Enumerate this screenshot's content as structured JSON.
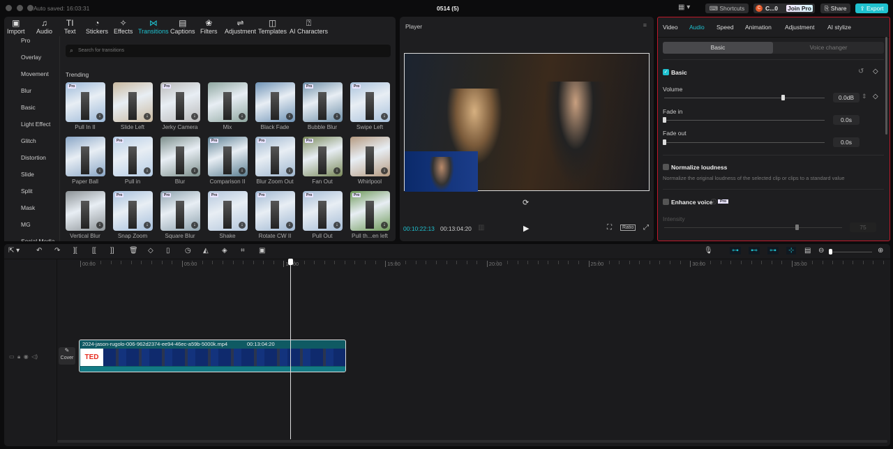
{
  "titlebar": {
    "autosave": "Auto saved: 16:03:31",
    "project": "0514 (5)",
    "shortcuts": "Shortcuts",
    "user": "C...0",
    "user_initial": "C",
    "join_pro": "Join Pro",
    "share": "Share",
    "export": "Export"
  },
  "toolbar": [
    {
      "icon": "import-icon",
      "glyph": "▣",
      "label": "Import"
    },
    {
      "icon": "audio-icon",
      "glyph": "♫",
      "label": "Audio"
    },
    {
      "icon": "text-icon",
      "glyph": "TI",
      "label": "Text"
    },
    {
      "icon": "stickers-icon",
      "glyph": "◔",
      "label": "Stickers"
    },
    {
      "icon": "effects-icon",
      "glyph": "✧",
      "label": "Effects"
    },
    {
      "icon": "transitions-icon",
      "glyph": "⋈",
      "label": "Transitions",
      "active": true
    },
    {
      "icon": "captions-icon",
      "glyph": "▤",
      "label": "Captions"
    },
    {
      "icon": "filters-icon",
      "glyph": "❀",
      "label": "Filters"
    },
    {
      "icon": "adjustment-icon",
      "glyph": "⇌",
      "label": "Adjustment"
    },
    {
      "icon": "templates-icon",
      "glyph": "◫",
      "label": "Templates"
    },
    {
      "icon": "ai-characters-icon",
      "glyph": "⍰",
      "label": "AI Characters"
    }
  ],
  "sidebar": [
    "Pro",
    "Overlay",
    "Movement",
    "Blur",
    "Basic",
    "Light Effect",
    "Glitch",
    "Distortion",
    "Slide",
    "Split",
    "Mask",
    "MG",
    "Social Media"
  ],
  "search": {
    "placeholder": "Search for transitions"
  },
  "section_title": "Trending",
  "transitions": [
    {
      "name": "Pull In II",
      "pro": true,
      "c": "#9bb8d8"
    },
    {
      "name": "Slide Left",
      "pro": false,
      "c": "#c9b9a0"
    },
    {
      "name": "Jerky Camera",
      "pro": true,
      "c": "#b9b9b9"
    },
    {
      "name": "Mix",
      "pro": false,
      "c": "#8fa7a0"
    },
    {
      "name": "Black Fade",
      "pro": false,
      "c": "#6f93b6"
    },
    {
      "name": "Bubble Blur",
      "pro": true,
      "c": "#6e8fa8"
    },
    {
      "name": "Swipe Left",
      "pro": true,
      "c": "#a9c2dc"
    },
    {
      "name": "Paper Ball",
      "pro": false,
      "c": "#8aa6c6"
    },
    {
      "name": "Pull in",
      "pro": true,
      "c": "#b6cde6"
    },
    {
      "name": "Blur",
      "pro": false,
      "c": "#7d8f8c"
    },
    {
      "name": "Comparison II",
      "pro": true,
      "c": "#5c7f92"
    },
    {
      "name": "Blur Zoom Out",
      "pro": true,
      "c": "#9eb6cf"
    },
    {
      "name": "Fan Out",
      "pro": true,
      "c": "#7a8a5a"
    },
    {
      "name": "Whirlpool",
      "pro": false,
      "c": "#b59a80"
    },
    {
      "name": "Vertical Blur",
      "pro": false,
      "c": "#8c9296"
    },
    {
      "name": "Snap Zoom",
      "pro": true,
      "c": "#a6bfdc"
    },
    {
      "name": "Square Blur",
      "pro": true,
      "c": "#8ea2ae"
    },
    {
      "name": "Shake",
      "pro": true,
      "c": "#b3c6dc"
    },
    {
      "name": "Rotate CW II",
      "pro": true,
      "c": "#9fb7d2"
    },
    {
      "name": "Pull Out",
      "pro": true,
      "c": "#a5bcd6"
    },
    {
      "name": "Pull th...en left",
      "pro": true,
      "c": "#6f9a5a"
    }
  ],
  "pro_badge": "Pro",
  "player": {
    "title": "Player",
    "current": "00:10:22:13",
    "total": "00:13:04:20",
    "ratio": "Ratio"
  },
  "right_panel": {
    "tabs": [
      "Video",
      "Audio",
      "Speed",
      "Animation",
      "Adjustment",
      "AI stylize"
    ],
    "active_tab": "Audio",
    "subtabs": [
      "Basic",
      "Voice changer"
    ],
    "section": "Basic",
    "volume": {
      "label": "Volume",
      "value": "0.0dB",
      "fraction": 0.75
    },
    "fade_in": {
      "label": "Fade in",
      "value": "0.0s"
    },
    "fade_out": {
      "label": "Fade out",
      "value": "0.0s"
    },
    "normalize": {
      "label": "Normalize loudness",
      "desc": "Normalize the original loudness of the selected clip or clips to a standard value"
    },
    "enhance": {
      "label": "Enhance voice",
      "badge": "Pro"
    },
    "intensity": {
      "label": "Intensity",
      "value": "75",
      "fraction": 0.75
    }
  },
  "timeline": {
    "ruler": [
      "00:00",
      "05:00",
      "10:00",
      "15:00",
      "20:00",
      "25:00",
      "30:00",
      "35:00"
    ],
    "clip": {
      "name": "2024-jason-rugolo-006-962d2374-ee94-46ec-a59b-5000k.mp4",
      "duration": "00:13:04:20"
    },
    "cover": "Cover",
    "accent": "#1fc1cf"
  }
}
